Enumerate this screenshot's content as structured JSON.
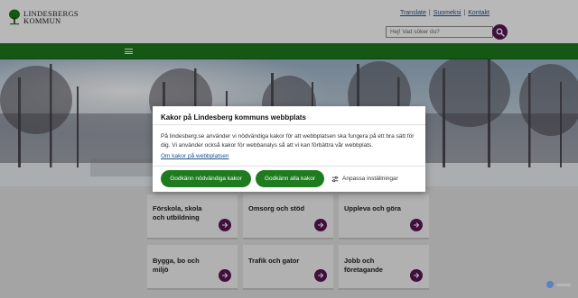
{
  "header": {
    "logo_line1": "LINDESBERGS",
    "logo_line2": "KOMMUN",
    "links": [
      "Translate",
      "Suomeksi",
      "Kontakt"
    ],
    "separator": "|",
    "search_placeholder": "Hej! Vad söker du?"
  },
  "cards": [
    {
      "title": "Förskola, skola och utbildning"
    },
    {
      "title": "Omsorg och stöd"
    },
    {
      "title": "Uppleva och göra"
    },
    {
      "title": "Bygga, bo och miljö"
    },
    {
      "title": "Trafik och gator"
    },
    {
      "title": "Jobb och företagande"
    }
  ],
  "cookie_modal": {
    "title": "Kakor på Lindesberg kommuns webbplats",
    "body": "På lindesberg.se använder vi nödvändiga kakor för att webbplatsen ska fungera på ett bra sätt för dig. Vi använder också kakor för webbanalys så att vi kan förbättra vår webbplats.",
    "link": "Om kakor på webbplatsen",
    "btn_necessary": "Godkänn nödvändiga kakor",
    "btn_all": "Godkänn alla kakor",
    "btn_adjust": "Anpassa inställningar"
  },
  "colors": {
    "brand_green": "#1e7b1e",
    "accent_purple": "#5a1654",
    "link_blue": "#1d4f8a"
  },
  "icons": {
    "search": "search-icon",
    "menu": "hamburger-menu-icon",
    "card_arrow": "arrow-right-icon",
    "adjust": "sliders-icon"
  }
}
